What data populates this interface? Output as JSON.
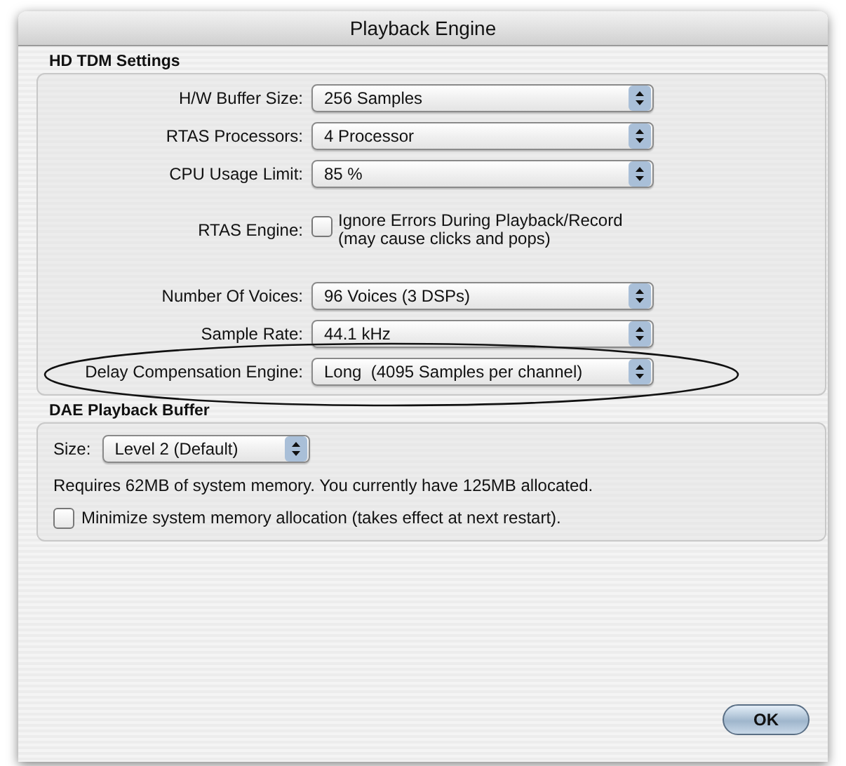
{
  "window": {
    "title": "Playback Engine"
  },
  "hd_tdm_settings": {
    "title": "HD TDM Settings",
    "rows": [
      {
        "kind": "select",
        "label": "H/W Buffer Size:",
        "value": "256 Samples"
      },
      {
        "kind": "select",
        "label": "RTAS Processors:",
        "value": "4 Processor"
      },
      {
        "kind": "select",
        "label": "CPU Usage Limit:",
        "value": "85 %"
      },
      {
        "kind": "checkbox",
        "label": "RTAS Engine:",
        "text": "Ignore Errors During Playback/Record (may cause clicks and pops)",
        "checked": false
      },
      {
        "kind": "select",
        "label": "Number Of Voices:",
        "value": "96 Voices (3 DSPs)"
      },
      {
        "kind": "select",
        "label": "Sample Rate:",
        "value": "44.1 kHz"
      },
      {
        "kind": "select",
        "label": "Delay Compensation Engine:",
        "value": "Long  (4095 Samples per channel)",
        "circled": true
      }
    ]
  },
  "dae_playback_buffer": {
    "title": "DAE Playback Buffer",
    "size_label": "Size:",
    "size_value": "Level 2 (Default)",
    "info": "Requires 62MB of system memory. You currently have 125MB allocated.",
    "minimize": {
      "text": "Minimize system memory allocation (takes effect at next restart).",
      "checked": false
    }
  },
  "buttons": [
    {
      "label": "OK"
    }
  ]
}
